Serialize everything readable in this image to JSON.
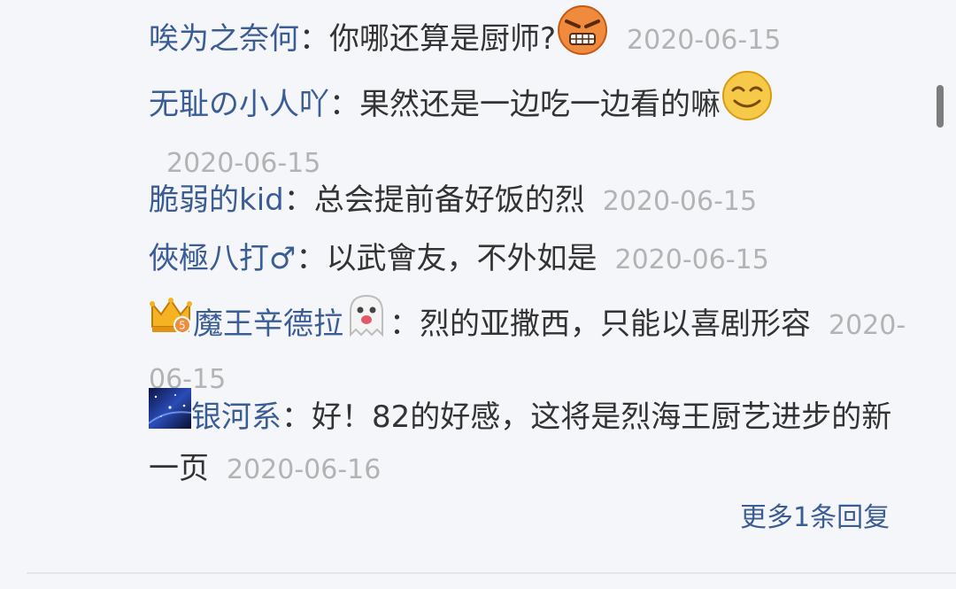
{
  "replies": [
    {
      "user": "唉为之奈何",
      "sep": "：",
      "text": "你哪还算是厨师?",
      "date": "2020-06-15",
      "emoji": "angry-face-emoji"
    },
    {
      "user": "无耻の小人吖",
      "sep": "：",
      "text": "果然还是一边吃一边看的嘛",
      "date": "2020-06-15",
      "emoji": "smile-face-emoji"
    },
    {
      "user": "脆弱的kid",
      "sep": "：",
      "text": "总会提前备好饭的烈",
      "date": "2020-06-15"
    },
    {
      "user": "俠極八打♂",
      "sep": "：",
      "text": "以武會友，不外如是",
      "date": "2020-06-15"
    },
    {
      "user": "魔王辛德拉",
      "sep": "：",
      "text": "烈的亚撒西，只能以喜剧形容",
      "date": "2020-06-15",
      "badge": "crown-badge-icon",
      "emoji": "ghost-emoji"
    },
    {
      "user": "银河系",
      "sep": "：",
      "text": "好！82的好感，这将是烈海王厨艺进步的新一页",
      "date": "2020-06-16",
      "avatar": "galaxy-avatar"
    }
  ],
  "more": {
    "label": "更多1条回复"
  },
  "colors": {
    "background": "#f5f6fa",
    "username": "#3b5d96",
    "text": "#333333",
    "date": "#b3b3b3",
    "link": "#3b5d96"
  }
}
